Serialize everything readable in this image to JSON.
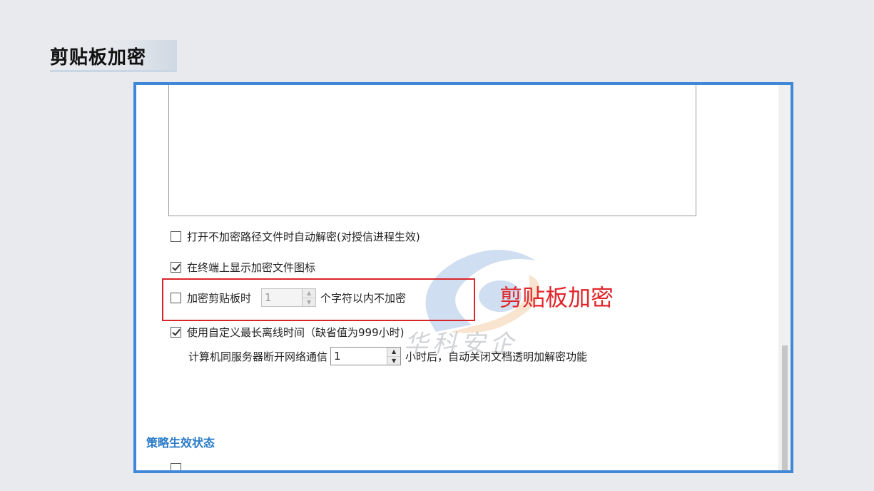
{
  "slide": {
    "title": "剪贴板加密"
  },
  "dialog": {
    "options": [
      {
        "label": "打开不加密路径文件时自动解密(对授信进程生效)",
        "checked": false
      },
      {
        "label": "在终端上显示加密文件图标",
        "checked": true
      },
      {
        "label": "加密剪贴板时",
        "checked": false,
        "spin_value": "1",
        "suffix": "个字符以内不加密",
        "disabled": true
      },
      {
        "label": "使用自定义最长离线时间（缺省值为999小时)",
        "checked": true
      }
    ],
    "offline": {
      "prefix": "计算机同服务器断开网络通信",
      "value": "1",
      "suffix": "小时后，自动关闭文档透明加解密功能"
    },
    "section_title": "策略生效状态",
    "annotation": "剪贴板加密",
    "watermark_text": "华科安企"
  },
  "colors": {
    "frame_border": "#3f88d8",
    "highlight_red": "#d9242a",
    "section_blue": "#2a7bc8"
  }
}
